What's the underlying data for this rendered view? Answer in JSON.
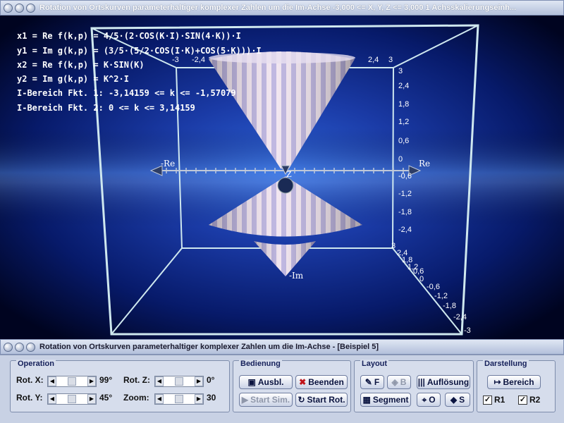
{
  "window": {
    "top_title": "Rotation von Ortskurven parameterhaltiger komplexer Zahlen um die Im-Achse   -3,000 <= X, Y, Z <= 3,000    1 Achsskalierungseinh...",
    "bottom_title": "Rotation von Ortskurven parameterhaltiger komplexer Zahlen um die Im-Achse - [Beispiel 5]"
  },
  "formulas": [
    "x1 = Re f(k,p) = 4/5·(2·COS(K·I)·SIN(4·K))·I",
    "y1 = Im g(k,p) = (3/5·(5/2·COS(I·K)+COS(5·K)))·I",
    "x2 = Re f(k,p) = K·SIN(K)",
    "y2 = Im g(k,p) = K^2·I",
    "I-Bereich Fkt. 1: -3,14159 <= k <= -1,57079",
    "I-Bereich Fkt. 2: 0 <= k <= 3,14159"
  ],
  "axes": {
    "re_neg": "-Re",
    "re_pos": "Re",
    "im_neg": "-Im",
    "z": "Z",
    "top_ticks": [
      "-3",
      "-2,4",
      "2,4",
      "3"
    ],
    "right_ticks": [
      "3",
      "2,4",
      "1,8",
      "1,2",
      "0,6",
      "0",
      "-0,6",
      "-1,2",
      "-1,8",
      "-2,4"
    ],
    "depth_ticks": [
      "3",
      "2,4",
      "1,8",
      "1,2",
      "0,6",
      "0",
      "-0,6",
      "-1,2",
      "-1,8",
      "-2,4",
      "-3"
    ]
  },
  "operation": {
    "label": "Operation",
    "rot_x_label": "Rot. X:",
    "rot_x_value": "99°",
    "rot_y_label": "Rot. Y:",
    "rot_y_value": "45°",
    "rot_z_label": "Rot. Z:",
    "rot_z_value": "0°",
    "zoom_label": "Zoom:",
    "zoom_value": "30"
  },
  "bedienung": {
    "label": "Bedienung",
    "ausbl": "Ausbl.",
    "beenden": "Beenden",
    "start_sim": "Start Sim.",
    "start_rot": "Start Rot."
  },
  "layout": {
    "label": "Layout",
    "f": "F",
    "b": "B",
    "aufloesung": "Auflösung",
    "segment": "Segment",
    "o": "O",
    "s": "S"
  },
  "darstellung": {
    "label": "Darstellung",
    "bereich": "Bereich",
    "r1": "R1",
    "r2": "R2"
  },
  "colors": {
    "background_center": "#1f47b8",
    "background_edge": "#000420",
    "box_frame": "#cfe8ef",
    "surface_stripe_a": "#f1e4ef",
    "surface_stripe_b": "#b9b0de"
  }
}
